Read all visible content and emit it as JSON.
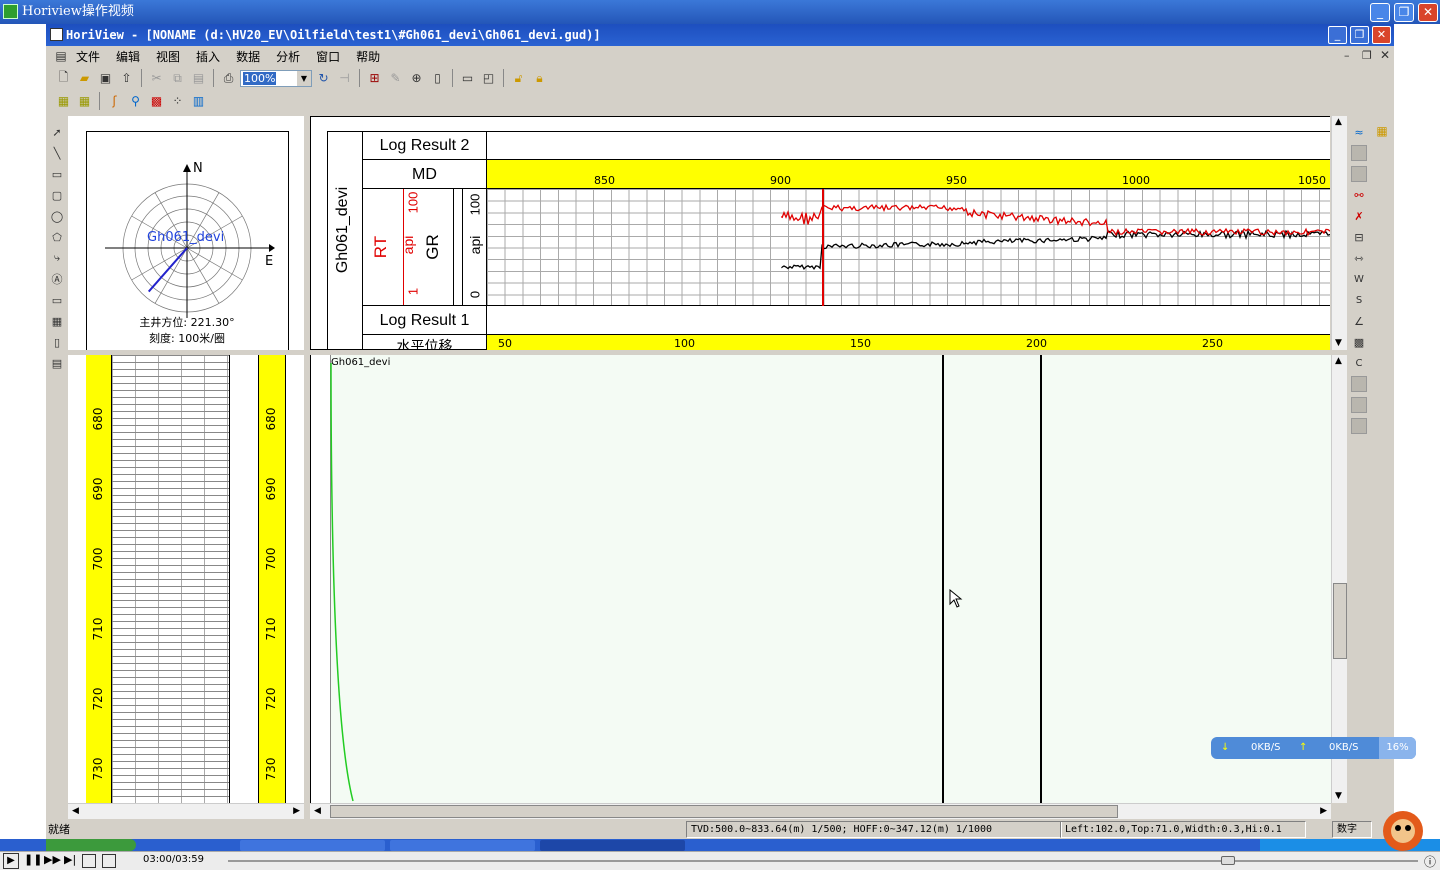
{
  "outer_window": {
    "title": "Horiview操作视频"
  },
  "app_window": {
    "title": "HoriView - [NONAME (d:\\HV20_EV\\Oilfield\\test1\\#Gh061_devi\\Gh061_devi.gud)]"
  },
  "menu": [
    "文件",
    "编辑",
    "视图",
    "插入",
    "数据",
    "分析",
    "窗口",
    "帮助"
  ],
  "toolbar": {
    "zoom_value": "100%"
  },
  "compass": {
    "well_name": "Gh061_devi",
    "north_label": "N",
    "east_label": "E",
    "azimuth_text": "主井方位: 221.30°",
    "scale_text": "刻度: 100米/圈",
    "azimuth_deg": 221.3
  },
  "depth_track": {
    "ticks": [
      "680",
      "690",
      "700",
      "710",
      "720",
      "730"
    ]
  },
  "log_header": {
    "well_label": "Gh061_devi",
    "result2_label": "Log Result 2",
    "md_label": "MD",
    "result1_label": "Log Result 1",
    "hoff_label": "水平位移",
    "rt": {
      "name": "RT",
      "unit": "api",
      "min": "1",
      "max": "100",
      "color": "#e00000"
    },
    "gr": {
      "name": "GR",
      "unit": "api",
      "min": "0",
      "max": "100",
      "color": "#000000"
    },
    "md_ticks": [
      "850",
      "900",
      "950",
      "1000",
      "1050"
    ],
    "hoff_ticks": [
      "50",
      "100",
      "150",
      "200",
      "250"
    ]
  },
  "section_view": {
    "well_label": "Gh061_devi"
  },
  "network_widget": {
    "down": "0KB/S",
    "up": "0KB/S",
    "percent": "16%"
  },
  "status": {
    "ready": "就绪",
    "tvd_info": "TVD:500.0~833.64(m) 1/500; HOFF:0~347.12(m) 1/1000",
    "position_info": "Left:102.0,Top:71.0,Width:0.3,Hi:0.1",
    "mode": "数字"
  },
  "player": {
    "time": "03:00/03:59",
    "progress": 0.84
  }
}
